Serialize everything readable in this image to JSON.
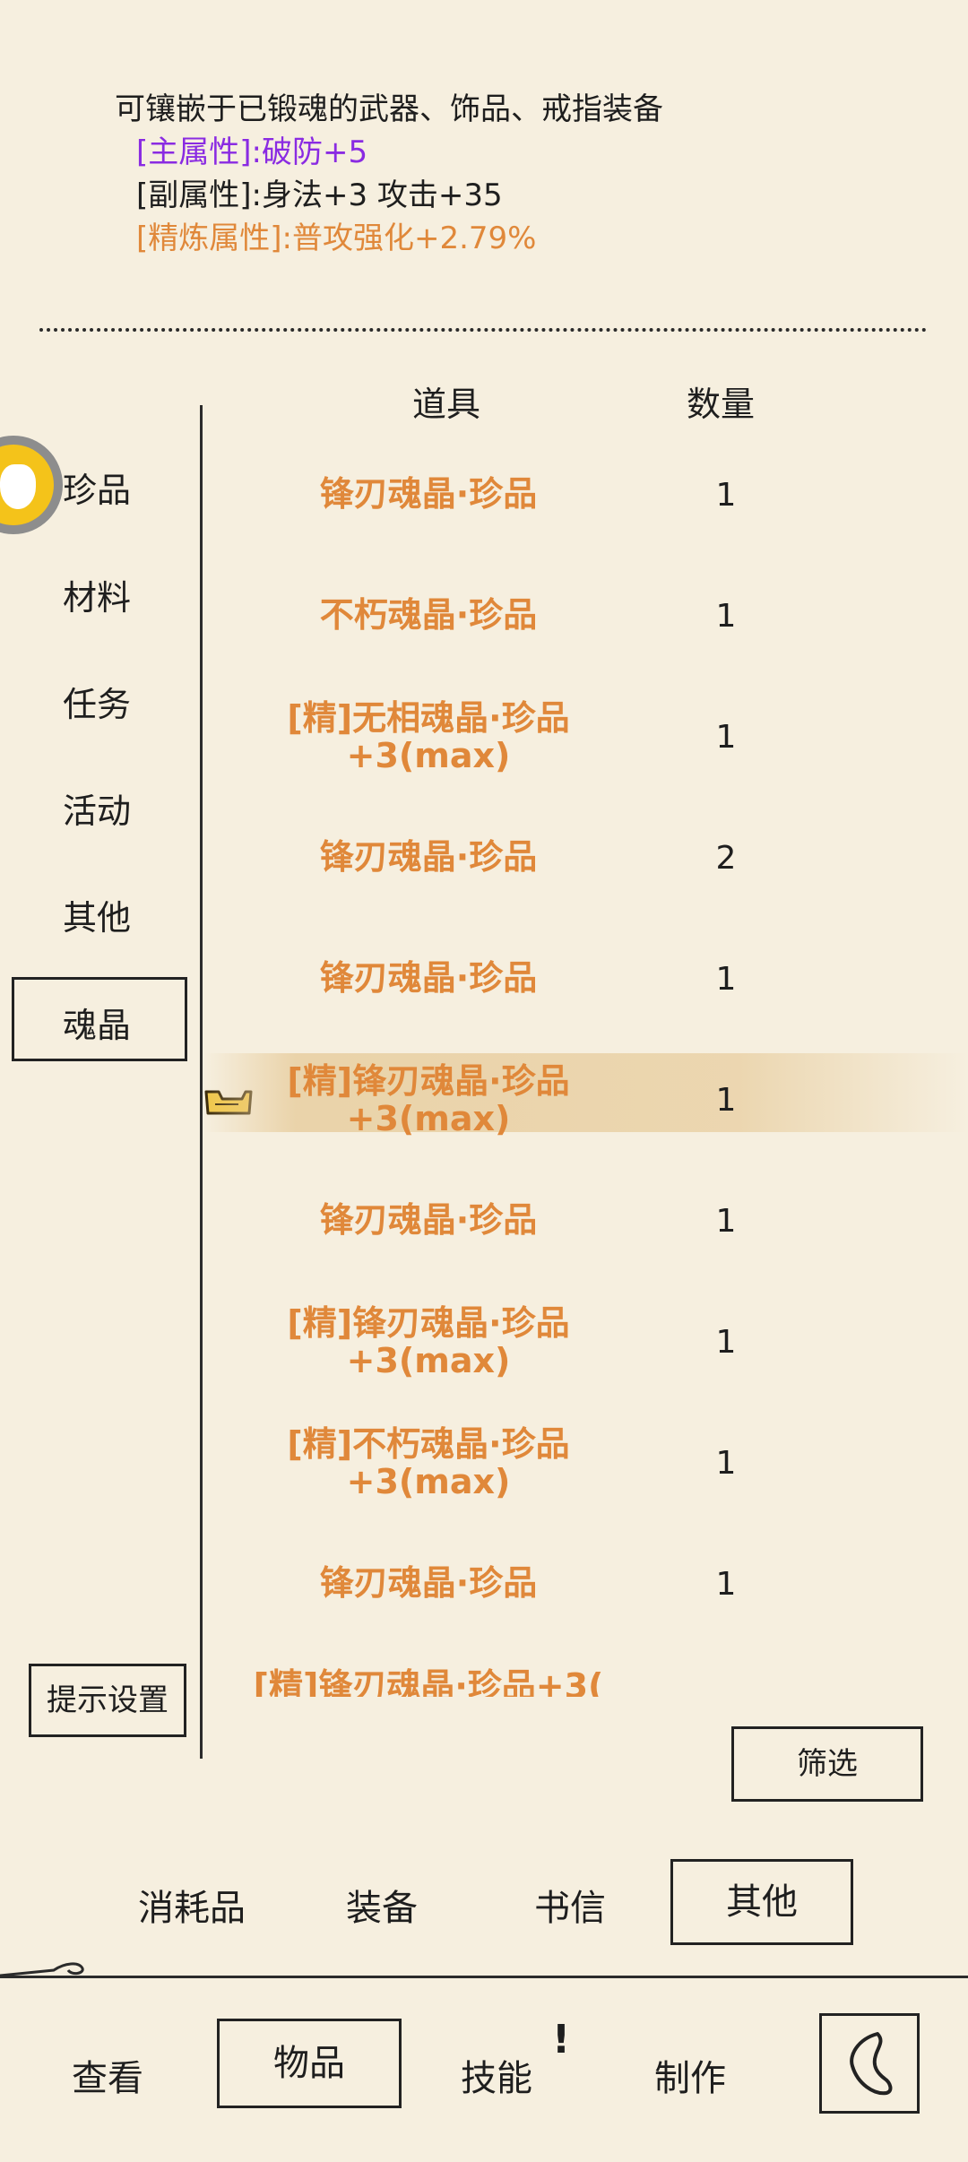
{
  "description": {
    "line1": "可镶嵌于已锻魂的武器、饰品、戒指装备",
    "main_attr_label": "[主属性]:",
    "main_attr_value": "破防+5",
    "sub_attr_label": "[副属性]:",
    "sub_attr_value": "身法+3 攻击+35",
    "refine_attr_label": "[精炼属性]:",
    "refine_attr_value": "普攻强化+2.79%"
  },
  "columns": {
    "item": "道具",
    "qty": "数量"
  },
  "categories": [
    "珍品",
    "材料",
    "任务",
    "活动",
    "其他",
    "魂晶"
  ],
  "selected_category": "魂晶",
  "items": [
    {
      "name": "锋刃魂晶·珍品",
      "qty": "1"
    },
    {
      "name": "不朽魂晶·珍品",
      "qty": "1"
    },
    {
      "name": "[精]无相魂晶·珍品+3(max)",
      "qty": "1"
    },
    {
      "name": "锋刃魂晶·珍品",
      "qty": "2"
    },
    {
      "name": "锋刃魂晶·珍品",
      "qty": "1"
    },
    {
      "name": "[精]锋刃魂晶·珍品+3(max)",
      "qty": "1"
    },
    {
      "name": "锋刃魂晶·珍品",
      "qty": "1"
    },
    {
      "name": "[精]锋刃魂晶·珍品+3(max)",
      "qty": "1"
    },
    {
      "name": "[精]不朽魂晶·珍品+3(max)",
      "qty": "1"
    },
    {
      "name": "锋刃魂晶·珍品",
      "qty": "1"
    },
    {
      "name": "[精]锋刃魂晶·珍品+3(",
      "qty": ""
    }
  ],
  "selected_item_index": 5,
  "buttons": {
    "hint_settings": "提示设置",
    "filter": "筛选"
  },
  "item_tabs": [
    "消耗品",
    "装备",
    "书信",
    "其他"
  ],
  "selected_item_tab": "其他",
  "main_tabs": [
    "查看",
    "物品",
    "技能",
    "制作"
  ],
  "selected_main_tab": "物品",
  "skill_badge": "!",
  "colors": {
    "accent": "#e0883a",
    "purple": "#8a2be2",
    "bg": "#f6efdf"
  }
}
